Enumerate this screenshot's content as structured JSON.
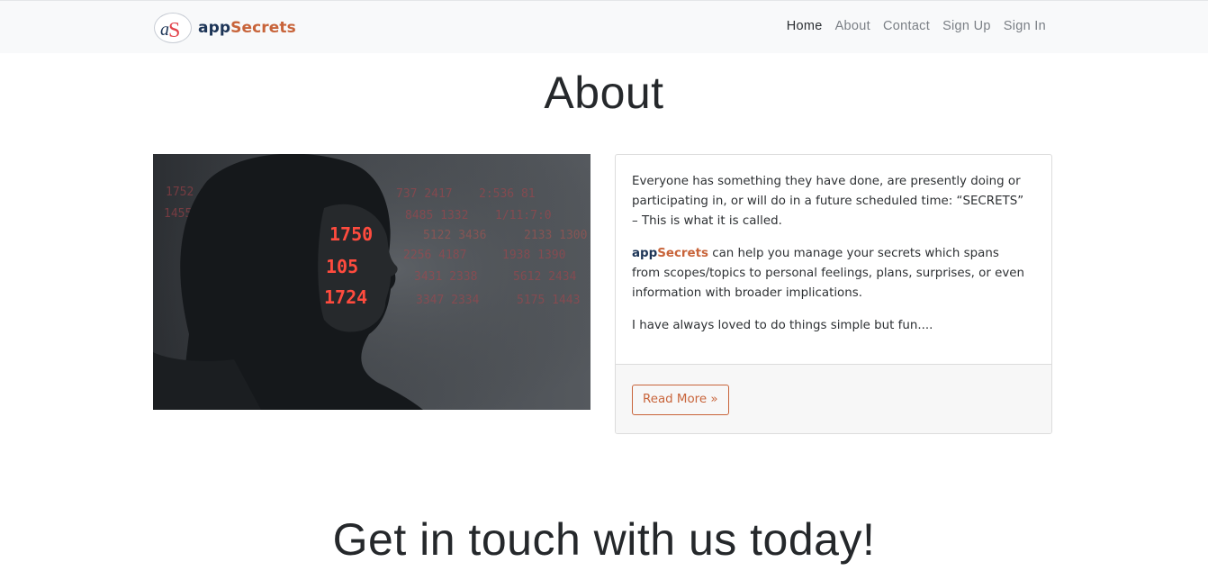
{
  "navbar": {
    "brand": {
      "part1": "app",
      "part2": "Secrets",
      "logo_letters": "aS"
    },
    "links": [
      {
        "label": "Home",
        "active": true
      },
      {
        "label": "About",
        "active": false
      },
      {
        "label": "Contact",
        "active": false
      },
      {
        "label": "Sign Up",
        "active": false
      },
      {
        "label": "Sign In",
        "active": false
      }
    ]
  },
  "about": {
    "title": "About",
    "image": {
      "overlay_numbers": [
        "1750",
        "105",
        "1724"
      ]
    },
    "card": {
      "paragraph1": "Everyone has something they have done, are presently doing or participating in, or will do in a future scheduled time: “SECRETS” – This is what it is called.",
      "paragraph2_brand_app": "app",
      "paragraph2_brand_secrets": "Secrets",
      "paragraph2_rest": " can help you manage your secrets which spans from scopes/topics to personal feelings, plans, surprises, or even information with broader implications.",
      "paragraph3": "I have always loved to do things simple but fun....",
      "read_more": "Read More »"
    }
  },
  "contact": {
    "title": "Get in touch with us today!"
  },
  "colors": {
    "accent": "#c8643a",
    "brand_dark": "#1d3557",
    "navbar_bg": "#f8f9fa"
  }
}
